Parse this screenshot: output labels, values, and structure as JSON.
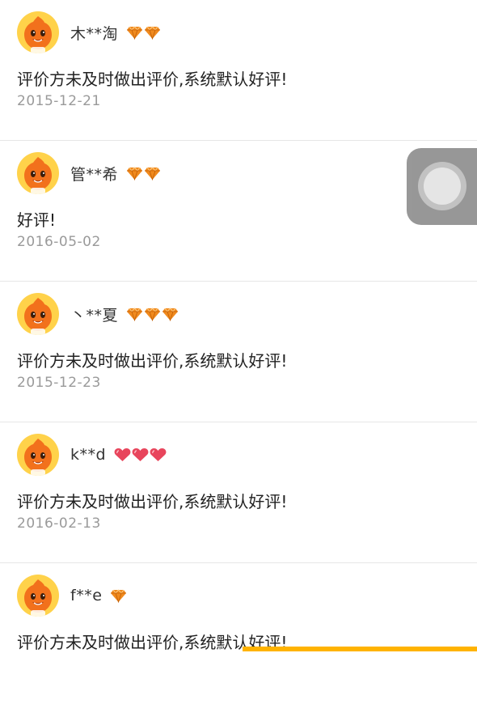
{
  "colors": {
    "accent": "#FFB300",
    "avatar_bg": "#FFD24A",
    "mascot": "#F2711C",
    "diamond": "#F08A1E",
    "heart": "#E8455C"
  },
  "reviews": [
    {
      "user": "木**淘",
      "badge_type": "diamond",
      "badge_count": 2,
      "content": "评价方未及时做出评价,系统默认好评!",
      "date": "2015-12-21"
    },
    {
      "user": "管**希",
      "badge_type": "diamond",
      "badge_count": 2,
      "content": "好评!",
      "date": "2016-05-02"
    },
    {
      "user": "丶**夏",
      "badge_type": "diamond",
      "badge_count": 3,
      "content": "评价方未及时做出评价,系统默认好评!",
      "date": "2015-12-23"
    },
    {
      "user": "k**d",
      "badge_type": "heart",
      "badge_count": 3,
      "content": "评价方未及时做出评价,系统默认好评!",
      "date": "2016-02-13"
    },
    {
      "user": "f**e",
      "badge_type": "diamond",
      "badge_count": 1,
      "content": "评价方未及时做出评价,系统默认好评!",
      "date": ""
    }
  ],
  "icons": {
    "avatar": "taobao-mascot-icon",
    "assistive_touch": "assistive-touch-icon"
  }
}
